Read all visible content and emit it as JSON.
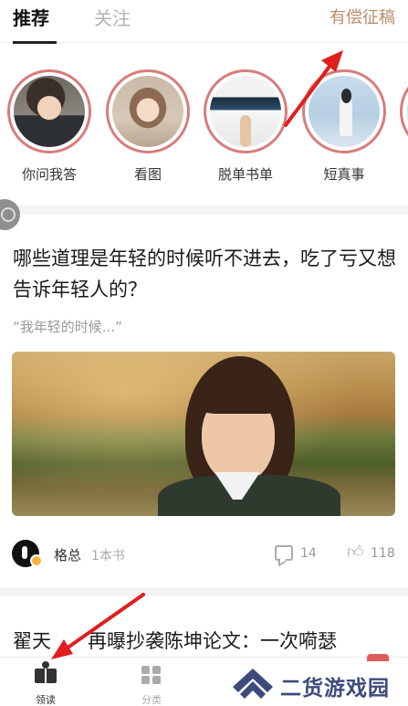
{
  "header": {
    "tabs": [
      {
        "label": "推荐",
        "active": true
      },
      {
        "label": "关注",
        "active": false
      }
    ],
    "paid_submission": "有偿征稿"
  },
  "stories": [
    {
      "label": "你问我答"
    },
    {
      "label": "看图"
    },
    {
      "label": "脱单书单"
    },
    {
      "label": "短真事"
    }
  ],
  "article": {
    "title": "哪些道理是年轻的时候听不进去，吃了亏又想告诉年轻人的？",
    "excerpt": "“我年轻的时候...”",
    "author": "格总",
    "book_count": "1本书",
    "comments": "14",
    "likes": "118"
  },
  "article2": {
    "title_start": "翟天",
    "title_end": "再曝抄袭陈坤论文：一次嗬瑟"
  },
  "bottom_nav": {
    "read": "领读",
    "category": "分类"
  },
  "watermark": "二货游戏园",
  "colors": {
    "accent_gold": "#b98e6a",
    "story_ring": "#d97b7b",
    "annotation_arrow": "#e01e1e",
    "watermark_blue": "#3e4a7e"
  }
}
